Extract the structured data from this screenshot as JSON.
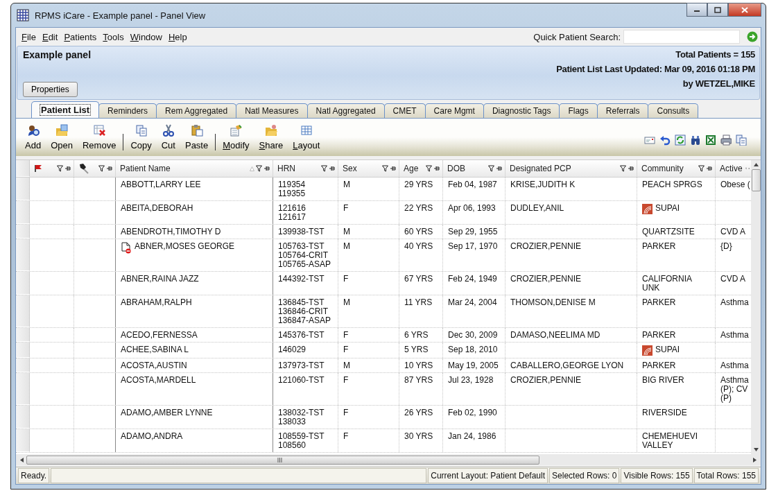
{
  "window": {
    "title": "RPMS iCare - Example panel - Panel View"
  },
  "menu": [
    {
      "label": "File"
    },
    {
      "label": "Edit"
    },
    {
      "label": "Patients"
    },
    {
      "label": "Tools"
    },
    {
      "label": "Window"
    },
    {
      "label": "Help"
    }
  ],
  "quick_search": {
    "label": "Quick Patient Search:"
  },
  "panel": {
    "title": "Example panel",
    "total": "Total Patients = 155",
    "updated": "Patient List Last Updated: Mar 09, 2016 01:18 PM",
    "by": "by WETZEL,MIKE",
    "button": "Properties"
  },
  "tabs": [
    {
      "label": "Patient List",
      "selected": true
    },
    {
      "label": "Reminders",
      "selected": false
    },
    {
      "label": "Rem Aggregated",
      "selected": false
    },
    {
      "label": "Natl Measures",
      "selected": false
    },
    {
      "label": "Natl Aggregated",
      "selected": false
    },
    {
      "label": "CMET",
      "selected": false
    },
    {
      "label": "Care Mgmt",
      "selected": false
    },
    {
      "label": "Diagnostic Tags",
      "selected": false
    },
    {
      "label": "Flags",
      "selected": false
    },
    {
      "label": "Referrals",
      "selected": false
    },
    {
      "label": "Consults",
      "selected": false
    }
  ],
  "toolbar": [
    [
      {
        "label": "Add"
      },
      {
        "label": "Open"
      },
      {
        "label": "Remove"
      }
    ],
    [
      {
        "label": "Copy"
      },
      {
        "label": "Cut"
      },
      {
        "label": "Paste"
      }
    ],
    [
      {
        "label": "Modify"
      },
      {
        "label": "Share"
      },
      {
        "label": "Layout"
      }
    ]
  ],
  "columns": [
    {
      "kind": "flag",
      "sorted": false
    },
    {
      "kind": "pen",
      "sorted": false
    },
    {
      "kind": "text",
      "label": "Patient Name",
      "sorted": true
    },
    {
      "kind": "text",
      "label": "HRN",
      "sorted": false
    },
    {
      "kind": "text",
      "label": "Sex",
      "sorted": false
    },
    {
      "kind": "text",
      "label": "Age",
      "sorted": false
    },
    {
      "kind": "text",
      "label": "DOB",
      "sorted": false
    },
    {
      "kind": "text",
      "label": "Designated PCP",
      "sorted": false
    },
    {
      "kind": "text",
      "label": "Community",
      "sorted": false
    },
    {
      "kind": "text",
      "label": "Active",
      "sorted": false
    }
  ],
  "rows": [
    {
      "name": "ABBOTT,LARRY LEE",
      "hrn": [
        "119354",
        "119355"
      ],
      "sex": "M",
      "age": "29 YRS",
      "dob": "Feb 04, 1987",
      "pcp": "KRISE,JUDITH K",
      "community": [
        "PEACH SPRGS"
      ],
      "active": [
        "Obese ("
      ],
      "name_icon": false,
      "community_logo": false
    },
    {
      "name": "ABEITA,DEBORAH",
      "hrn": [
        "121616",
        "121617"
      ],
      "sex": "F",
      "age": "22 YRS",
      "dob": "Apr 06, 1993",
      "pcp": "DUDLEY,ANIL",
      "community": [
        "SUPAI"
      ],
      "name_icon": false,
      "community_logo": true
    },
    {
      "name": "ABENDROTH,TIMOTHY D",
      "hrn": [
        "139938-TST"
      ],
      "sex": "M",
      "age": "60 YRS",
      "dob": "Sep 29, 1955",
      "community": [
        "QUARTZSITE"
      ],
      "active": [
        "CVD A"
      ],
      "name_icon": false,
      "community_logo": false
    },
    {
      "name": "ABNER,MOSES GEORGE",
      "name_icon": true,
      "community_logo": false,
      "hrn": [
        "105763-TST",
        "105764-CRIT",
        "105765-ASAP"
      ],
      "sex": "M",
      "age": "40 YRS",
      "dob": "Sep 17, 1970",
      "pcp": "CROZIER,PENNIE",
      "community": [
        "PARKER"
      ],
      "active": [
        "{D}"
      ]
    },
    {
      "name": "ABNER,RAINA JAZZ",
      "hrn": [
        "144392-TST"
      ],
      "sex": "F",
      "age": "67 YRS",
      "dob": "Feb 24, 1949",
      "pcp": "CROZIER,PENNIE",
      "community": [
        "CALIFORNIA",
        "UNK"
      ],
      "active": [
        "CVD A"
      ],
      "name_icon": false,
      "community_logo": false
    },
    {
      "name": "ABRAHAM,RALPH",
      "hrn": [
        "136845-TST",
        "136846-CRIT",
        "136847-ASAP"
      ],
      "sex": "M",
      "age": "11 YRS",
      "dob": "Mar 24, 2004",
      "pcp": "THOMSON,DENISE M",
      "community": [
        "PARKER"
      ],
      "active": [
        "Asthma"
      ],
      "name_icon": false,
      "community_logo": false
    },
    {
      "name": "ACEDO,FERNESSA",
      "hrn": [
        "145376-TST"
      ],
      "sex": "F",
      "age": "6 YRS",
      "dob": "Dec 30, 2009",
      "pcp": "DAMASO,NEELIMA MD",
      "community": [
        "PARKER"
      ],
      "active": [
        "Asthma"
      ],
      "name_icon": false,
      "community_logo": false
    },
    {
      "name": "ACHEE,SABINA L",
      "hrn": [
        "146029"
      ],
      "sex": "F",
      "age": "5 YRS",
      "dob": "Sep 18, 2010",
      "community": [
        "SUPAI"
      ],
      "name_icon": false,
      "community_logo": true
    },
    {
      "name": "ACOSTA,AUSTIN",
      "hrn": [
        "137973-TST"
      ],
      "sex": "M",
      "age": "10 YRS",
      "dob": "May 19, 2005",
      "pcp": "CABALLERO,GEORGE LYON",
      "community": [
        "PARKER"
      ],
      "active": [
        "Asthma"
      ],
      "name_icon": false,
      "community_logo": false
    },
    {
      "name": "ACOSTA,MARDELL",
      "hrn": [
        "121060-TST"
      ],
      "sex": "F",
      "age": "87 YRS",
      "dob": "Jul 23, 1928",
      "pcp": "CROZIER,PENNIE",
      "community": [
        "BIG RIVER"
      ],
      "active": [
        "Asthma",
        "(P); CV",
        "(P)"
      ],
      "name_icon": false,
      "community_logo": false
    },
    {
      "name": "ADAMO,AMBER LYNNE",
      "hrn": [
        "138032-TST",
        "138033"
      ],
      "sex": "F",
      "age": "26 YRS",
      "dob": "Feb 02, 1990",
      "community": [
        "RIVERSIDE"
      ],
      "name_icon": false,
      "community_logo": false
    },
    {
      "name": "ADAMO,ANDRA",
      "hrn": [
        "108559-TST",
        "108560"
      ],
      "sex": "F",
      "age": "30 YRS",
      "dob": "Jan 24, 1986",
      "community": [
        "CHEMEHUEVI",
        "VALLEY"
      ],
      "name_icon": false,
      "community_logo": false
    }
  ],
  "status": {
    "ready": "Ready.",
    "layout": "Current Layout: Patient Default",
    "selected": "Selected Rows: 0",
    "visible": "Visible Rows: 155",
    "total": "Total Rows: 155"
  }
}
